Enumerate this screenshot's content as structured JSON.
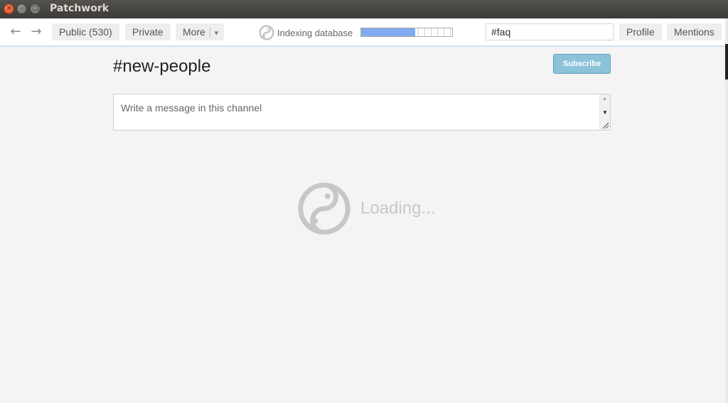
{
  "window": {
    "title": "Patchwork",
    "close_glyph": "×",
    "min_glyph": "–",
    "max_glyph": "□"
  },
  "toolbar": {
    "back_glyph": "←",
    "forward_glyph": "→",
    "public_label": "Public (530)",
    "private_label": "Private",
    "more_label": "More",
    "more_caret": "▼",
    "indexing_label": "Indexing database",
    "indexing_progress": 0.59,
    "search_value": "#faq",
    "profile_label": "Profile",
    "mentions_label": "Mentions"
  },
  "channel": {
    "title": "#new-people",
    "subscribe_label": "Subscribe",
    "composer_placeholder": "Write a message in this channel",
    "scroll_up_glyph": "▲",
    "scroll_down_glyph": "▼"
  },
  "loading": {
    "text": "Loading..."
  },
  "colors": {
    "accent_progress": "#82aaf0",
    "subscribe_bg": "#8cc3d9",
    "loading_gray": "#c7c7c7"
  },
  "icons": {
    "app_logo": "patchwork-logo-icon",
    "back": "arrow-left-icon",
    "forward": "arrow-right-icon",
    "dropdown": "chevron-down-icon"
  }
}
